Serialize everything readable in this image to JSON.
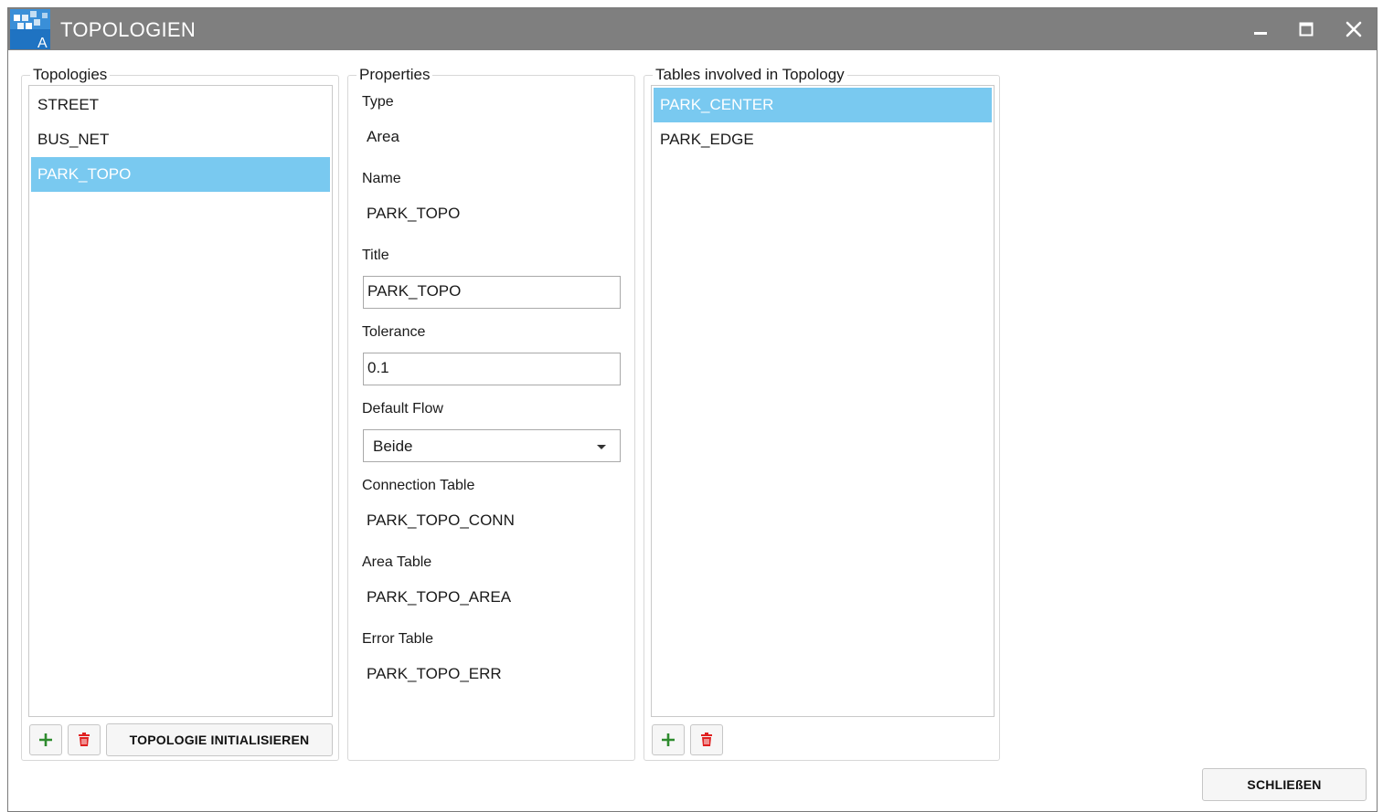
{
  "window": {
    "title": "TOPOLOGIEN",
    "app_icon": "app-logo-icon",
    "controls": [
      "minimize-icon",
      "maximize-icon",
      "close-icon"
    ]
  },
  "topologies": {
    "legend": "Topologies",
    "items": [
      {
        "label": "STREET",
        "selected": false
      },
      {
        "label": "BUS_NET",
        "selected": false
      },
      {
        "label": "PARK_TOPO",
        "selected": true
      }
    ],
    "add_icon": "plus-icon",
    "delete_icon": "trash-icon",
    "init_button": "TOPOLOGIE INITIALISIEREN"
  },
  "properties": {
    "legend": "Properties",
    "type_label": "Type",
    "type_value": "Area",
    "name_label": "Name",
    "name_value": "PARK_TOPO",
    "title_label": "Title",
    "title_value": "PARK_TOPO",
    "tolerance_label": "Tolerance",
    "tolerance_value": "0.1",
    "default_flow_label": "Default Flow",
    "default_flow_value": "Beide",
    "connection_table_label": "Connection Table",
    "connection_table_value": "PARK_TOPO_CONN",
    "area_table_label": "Area Table",
    "area_table_value": "PARK_TOPO_AREA",
    "error_table_label": "Error Table",
    "error_table_value": "PARK_TOPO_ERR"
  },
  "tables": {
    "legend": "Tables involved in Topology",
    "items": [
      {
        "label": "PARK_CENTER",
        "selected": true
      },
      {
        "label": "PARK_EDGE",
        "selected": false
      }
    ],
    "add_icon": "plus-icon",
    "delete_icon": "trash-icon"
  },
  "footer": {
    "close_button": "SCHLIEßEN"
  },
  "colors": {
    "titlebar": "#7f7f7f",
    "selection": "#79c9f0",
    "add": "#2e8b2e",
    "delete": "#e02020"
  }
}
